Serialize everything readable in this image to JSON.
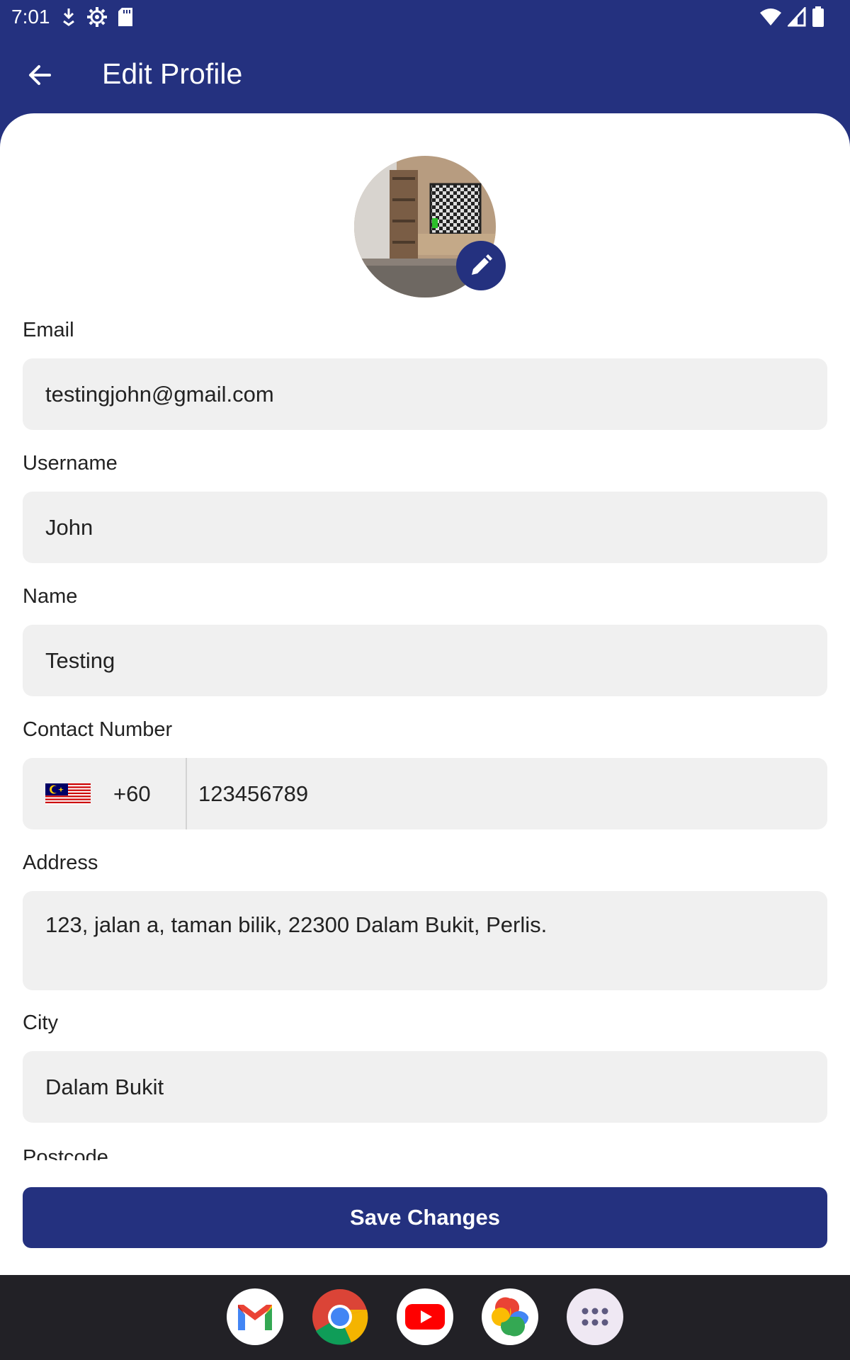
{
  "status_bar": {
    "time": "7:01",
    "icons_left": [
      "download-icon",
      "settings-icon",
      "sd-card-icon"
    ],
    "icons_right": [
      "wifi-icon",
      "signal-icon",
      "battery-icon"
    ]
  },
  "app_bar": {
    "title": "Edit Profile",
    "back_icon": "arrow-back-icon"
  },
  "colors": {
    "primary": "#24317f",
    "field_bg": "#f0f0f0",
    "dock_bg": "#222126"
  },
  "form": {
    "email": {
      "label": "Email",
      "value": "testingjohn@gmail.com"
    },
    "username": {
      "label": "Username",
      "value": "John"
    },
    "name": {
      "label": "Name",
      "value": "Testing"
    },
    "contact": {
      "label": "Contact Number",
      "country_code": "+60",
      "value": "123456789",
      "flag_icon": "malaysia-flag-icon"
    },
    "address": {
      "label": "Address",
      "value": "123, jalan a, taman bilik, 22300 Dalam Bukit, Perlis."
    },
    "city": {
      "label": "City",
      "value": "Dalam Bukit"
    },
    "postcode": {
      "label": "Postcode"
    }
  },
  "save_button": {
    "label": "Save Changes"
  },
  "dock": {
    "apps": [
      "gmail-icon",
      "chrome-icon",
      "youtube-icon",
      "photos-icon",
      "app-drawer-icon"
    ]
  }
}
